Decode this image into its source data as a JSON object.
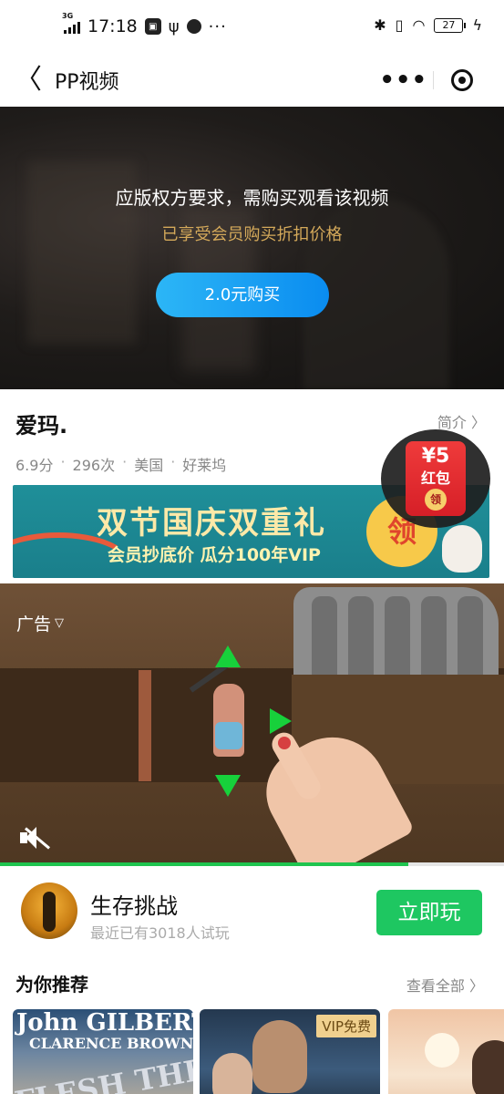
{
  "status_bar": {
    "network": "3G",
    "time": "17:18",
    "battery": "27"
  },
  "nav": {
    "title": "PP视频"
  },
  "paywall": {
    "message": "应版权方要求，需购买观看该视频",
    "member_note": "已享受会员购买折扣价格",
    "buy_label": "2.0元购买"
  },
  "video": {
    "title": "爱玛.",
    "intro_label": "简介 〉",
    "rating": "6.9分",
    "views": "296次",
    "country": "美国",
    "source": "好莱坞"
  },
  "red_packet": {
    "amount": "¥5",
    "label": "红包",
    "take": "领"
  },
  "promo": {
    "headline": "双节国庆双重礼",
    "subline": "会员抄底价 瓜分100年VIP",
    "claim": "领"
  },
  "ad": {
    "label": "广告",
    "progress": 0.81
  },
  "app_promo": {
    "name": "生存挑战",
    "subtitle": "最近已有3018人试玩",
    "play_label": "立即玩"
  },
  "recommend": {
    "heading": "为你推荐",
    "see_all": "查看全部 〉",
    "cards": [
      {
        "poster_line1": "John GILBERT",
        "poster_line2": "CLARENCE BROWNS",
        "poster_line3": "FLESH THE DEVIL"
      },
      {
        "badge": "VIP免费"
      },
      {}
    ]
  },
  "icons": {
    "back": "back-arrow-icon",
    "capsule_more": "more-dots-icon",
    "capsule_close": "close-target-icon",
    "mute": "mute-icon"
  },
  "colors": {
    "buy_button": "#1a9ff3",
    "member_note": "#d4a95a",
    "play_button": "#1ec761",
    "red_packet": "#e02b30"
  }
}
